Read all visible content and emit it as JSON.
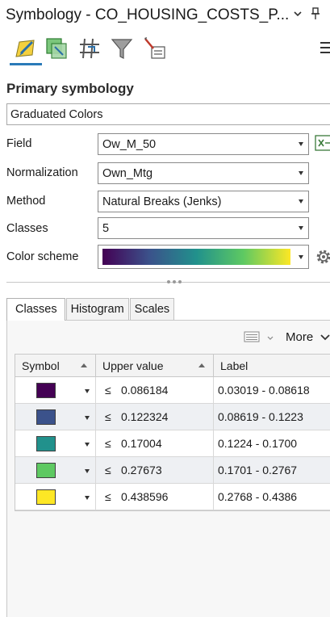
{
  "window": {
    "title": "Symbology - CO_HOUSING_COSTS_P..."
  },
  "toolbar": {
    "icons": [
      "primary-symbology-icon",
      "vary-symbology-icon",
      "label-classes-icon",
      "filter-icon",
      "symbol-layer-drawing-icon"
    ]
  },
  "primary": {
    "heading": "Primary symbology",
    "renderer": "Graduated Colors"
  },
  "fields": {
    "field_label": "Field",
    "field_value": "Ow_M_50",
    "normalization_label": "Normalization",
    "normalization_value": "Own_Mtg",
    "method_label": "Method",
    "method_value": "Natural Breaks (Jenks)",
    "classes_label": "Classes",
    "classes_value": "5",
    "colorscheme_label": "Color scheme",
    "colorscheme_colors": [
      "#440154",
      "#3b528b",
      "#21918c",
      "#5ec962",
      "#fde725"
    ]
  },
  "tabs": [
    {
      "label": "Classes",
      "active": true
    },
    {
      "label": "Histogram",
      "active": false
    },
    {
      "label": "Scales",
      "active": false
    }
  ],
  "tab_toolbar": {
    "more_label": "More"
  },
  "table": {
    "headers": {
      "symbol": "Symbol",
      "upper": "Upper value",
      "label": "Label"
    },
    "le_symbol": "≤",
    "rows": [
      {
        "color": "#440154",
        "upper": "0.086184",
        "label": "0.03019 - 0.08618"
      },
      {
        "color": "#3b528b",
        "upper": "0.122324",
        "label": "0.08619 - 0.1223"
      },
      {
        "color": "#21918c",
        "upper": "0.17004",
        "label": "0.1224 - 0.1700"
      },
      {
        "color": "#5ec962",
        "upper": "0.27673",
        "label": "0.1701 - 0.2767"
      },
      {
        "color": "#fde725",
        "upper": "0.438596",
        "label": "0.2768 - 0.4386"
      }
    ]
  }
}
